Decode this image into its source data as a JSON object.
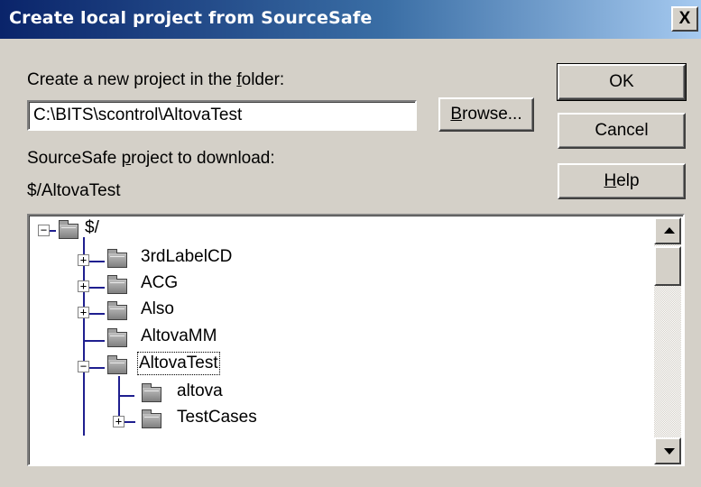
{
  "window": {
    "title": "Create local project from SourceSafe",
    "close_label": "X"
  },
  "folder": {
    "label_pre": "Create a new project in the ",
    "label_key": "f",
    "label_post": "older:",
    "value": "C:\\BITS\\scontrol\\AltovaTest",
    "browse_key": "B",
    "browse_rest": "rowse..."
  },
  "buttons": {
    "ok": "OK",
    "cancel": "Cancel",
    "help_key": "H",
    "help_rest": "elp"
  },
  "project": {
    "label_pre": "SourceSafe ",
    "label_key": "p",
    "label_post": "roject to download:",
    "value": "$/AltovaTest"
  },
  "tree": {
    "root": {
      "label": "$/",
      "expander": "−"
    },
    "items": [
      {
        "label": "3rdLabelCD",
        "expander": "+"
      },
      {
        "label": "ACG",
        "expander": "+"
      },
      {
        "label": "Also",
        "expander": "+"
      },
      {
        "label": "AltovaMM",
        "expander": ""
      },
      {
        "label": "AltovaTest",
        "expander": "−",
        "selected": true
      }
    ],
    "children": [
      {
        "label": "altova",
        "expander": ""
      },
      {
        "label": "TestCases",
        "expander": "+"
      }
    ]
  }
}
